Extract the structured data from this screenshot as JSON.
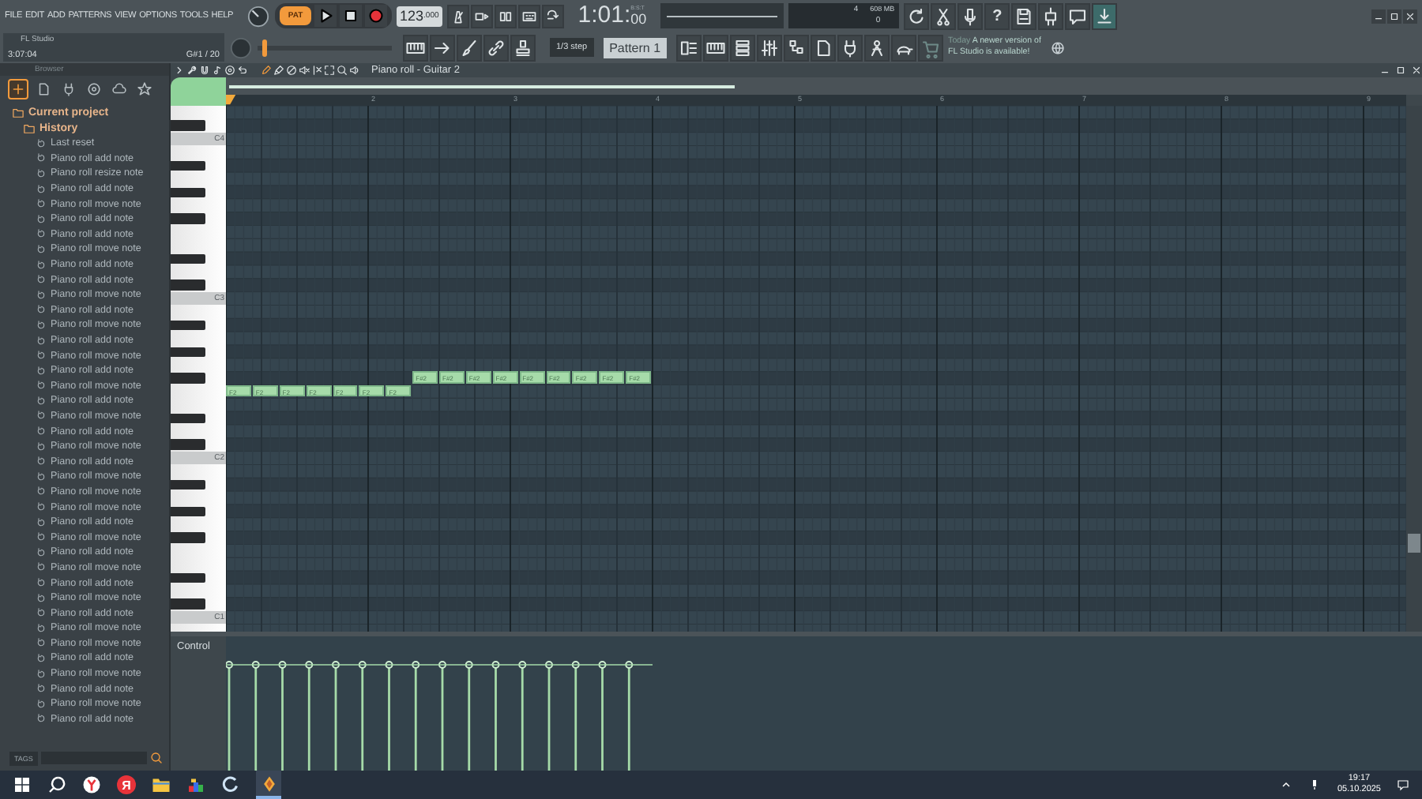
{
  "menu": [
    "FILE",
    "EDIT",
    "ADD",
    "PATTERNS",
    "VIEW",
    "OPTIONS",
    "TOOLS",
    "HELP"
  ],
  "hint_panel": {
    "title": "FL Studio",
    "time": "3:07:04",
    "note": "G#1 / 20"
  },
  "transport": {
    "mode": "PAT",
    "tempo": "123",
    "tempo_fraction": ".000",
    "time": "1:01:",
    "time_ticks": "00",
    "time_format": "B:S:T"
  },
  "cpu_panel": {
    "cpu": "4",
    "memory": "608 MB",
    "polyphony": "0"
  },
  "master_pitch": {
    "level": 0.04
  },
  "help_glyph": "?",
  "snap": "1/3 step",
  "pattern": "Pattern 1",
  "news": {
    "label": "Today",
    "text": "A newer version of FL Studio is available!"
  },
  "browser": {
    "title": "Browser",
    "tabs": [
      {
        "selected": true
      },
      {
        "selected": false
      },
      {
        "selected": false
      },
      {
        "selected": false
      },
      {
        "selected": false
      },
      {
        "selected": false
      }
    ]
  },
  "tree": [
    {
      "label": "Current project",
      "children": [
        {
          "label": "History",
          "children": [
            {
              "label": "Last reset"
            },
            {
              "label": "Piano roll add note"
            },
            {
              "label": "Piano roll resize note"
            },
            {
              "label": "Piano roll add note"
            },
            {
              "label": "Piano roll move note"
            },
            {
              "label": "Piano roll add note"
            },
            {
              "label": "Piano roll add note"
            },
            {
              "label": "Piano roll move note"
            },
            {
              "label": "Piano roll add note"
            },
            {
              "label": "Piano roll add note"
            },
            {
              "label": "Piano roll move note"
            },
            {
              "label": "Piano roll add note"
            },
            {
              "label": "Piano roll move note"
            },
            {
              "label": "Piano roll add note"
            },
            {
              "label": "Piano roll move note"
            },
            {
              "label": "Piano roll add note"
            },
            {
              "label": "Piano roll move note"
            },
            {
              "label": "Piano roll add note"
            },
            {
              "label": "Piano roll move note"
            },
            {
              "label": "Piano roll add note"
            },
            {
              "label": "Piano roll move note"
            },
            {
              "label": "Piano roll add note"
            },
            {
              "label": "Piano roll move note"
            },
            {
              "label": "Piano roll move note"
            },
            {
              "label": "Piano roll move note"
            },
            {
              "label": "Piano roll add note"
            },
            {
              "label": "Piano roll move note"
            },
            {
              "label": "Piano roll add note"
            },
            {
              "label": "Piano roll move note"
            },
            {
              "label": "Piano roll add note"
            },
            {
              "label": "Piano roll move note"
            },
            {
              "label": "Piano roll add note"
            },
            {
              "label": "Piano roll move note"
            },
            {
              "label": "Piano roll move note"
            },
            {
              "label": "Piano roll add note"
            },
            {
              "label": "Piano roll move note"
            },
            {
              "label": "Piano roll add note"
            },
            {
              "label": "Piano roll move note"
            },
            {
              "label": "Piano roll add note"
            }
          ]
        }
      ]
    }
  ],
  "tags": {
    "label": "TAGS"
  },
  "piano_roll": {
    "title": "Piano roll - Guitar 2",
    "bar_numbers": [
      "2",
      "3",
      "4",
      "5",
      "6",
      "7",
      "8",
      "9"
    ],
    "octave_labels": [
      "C4",
      "C3",
      "C2",
      "C1"
    ],
    "note_lanes": [
      {
        "notes": [
          "F2",
          "F2",
          "F2",
          "F2",
          "F2",
          "F2",
          "F2"
        ]
      },
      {
        "notes": [
          "F#2",
          "F#2",
          "F#2",
          "F#2",
          "F#2",
          "F#2",
          "F#2",
          "F#2",
          "F#2"
        ]
      }
    ],
    "control": {
      "label": "Control"
    }
  },
  "taskbar": {
    "app_letter": "Я",
    "time": "19:17",
    "date": "05.10.2025"
  }
}
